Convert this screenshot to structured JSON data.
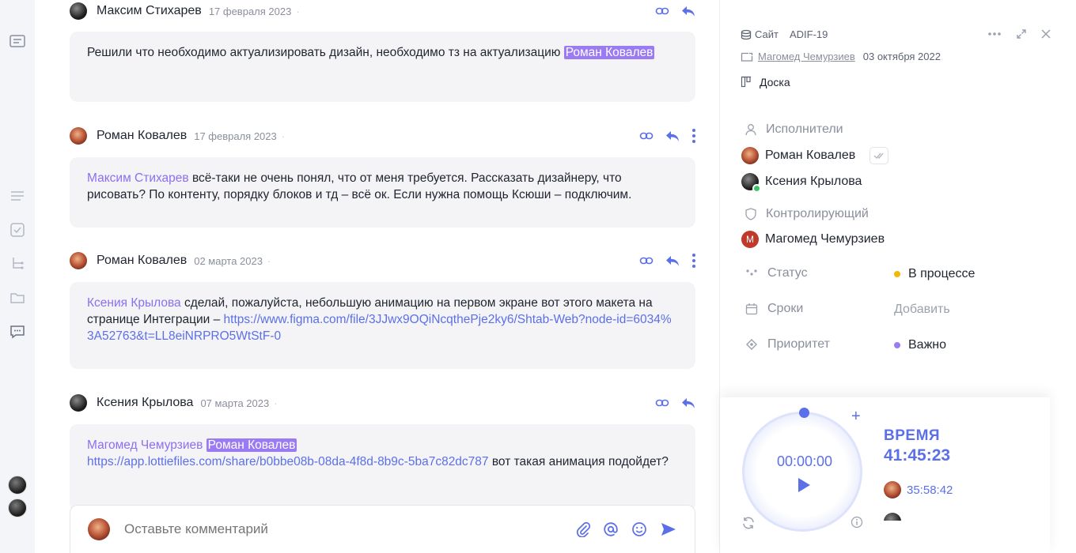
{
  "colors": {
    "accent": "#5b70e8",
    "mention": "#8b6ff0",
    "status_in_progress": "#f5b800",
    "priority_important": "#9b7bf2"
  },
  "messages": [
    {
      "author": "Максим Стихарев",
      "date": "17 февраля 2023",
      "text": "Решили что необходимо актуализировать дизайн, необходимо тз на актуализацию",
      "mention": "Роман Ковалев"
    },
    {
      "author": "Роман Ковалев",
      "date": "17 февраля 2023",
      "mention": "Максим Стихарев",
      "text": "всё-таки не очень понял, что от меня требуется. Рассказать дизайнеру, что рисовать? По контенту, порядку блоков и тд – всё ок. Если нужна помощь Ксюши – подключим."
    },
    {
      "author": "Роман Ковалев",
      "date": "02 марта 2023",
      "mention": "Ксения Крылова",
      "text": "сделай, пожалуйста, небольшую анимацию на первом экране вот этого макета на странице Интеграции –",
      "link": "https://www.figma.com/file/3JJwx9OQiNcqthePje2ky6/Shtab-Web?node-id=6034%3A52763&t=LL8eiNRPRO5WtStF-0"
    },
    {
      "author": "Ксения Крылова",
      "date": "07 марта 2023",
      "mention": "Магомед Чемурзиев",
      "mention2": "Роман Ковалев",
      "link": "https://app.lottiefiles.com/share/b0bbe08b-08da-4f8d-8b9c-5ba7c82dc787",
      "text": "вот такая анимация подойдет?"
    }
  ],
  "composer": {
    "placeholder": "Оставьте комментарий"
  },
  "panel": {
    "project": "Сайт",
    "code": "ADIF-19",
    "author": "Магомед Чемурзиев",
    "created": "03 октября 2022",
    "board": "Доска",
    "assignees_label": "Исполнители",
    "assignees": [
      "Роман Ковалев",
      "Ксения Крылова"
    ],
    "controller_label": "Контролирующий",
    "controller": "Магомед Чемурзиев",
    "controller_initial": "М",
    "status_label": "Статус",
    "status_value": "В процессе",
    "deadline_label": "Сроки",
    "deadline_value": "Добавить",
    "priority_label": "Приоритет",
    "priority_value": "Важно"
  },
  "timer": {
    "current": "00:00:00",
    "title": "ВРЕМЯ",
    "total": "41:45:23",
    "user_time": "35:58:42"
  }
}
